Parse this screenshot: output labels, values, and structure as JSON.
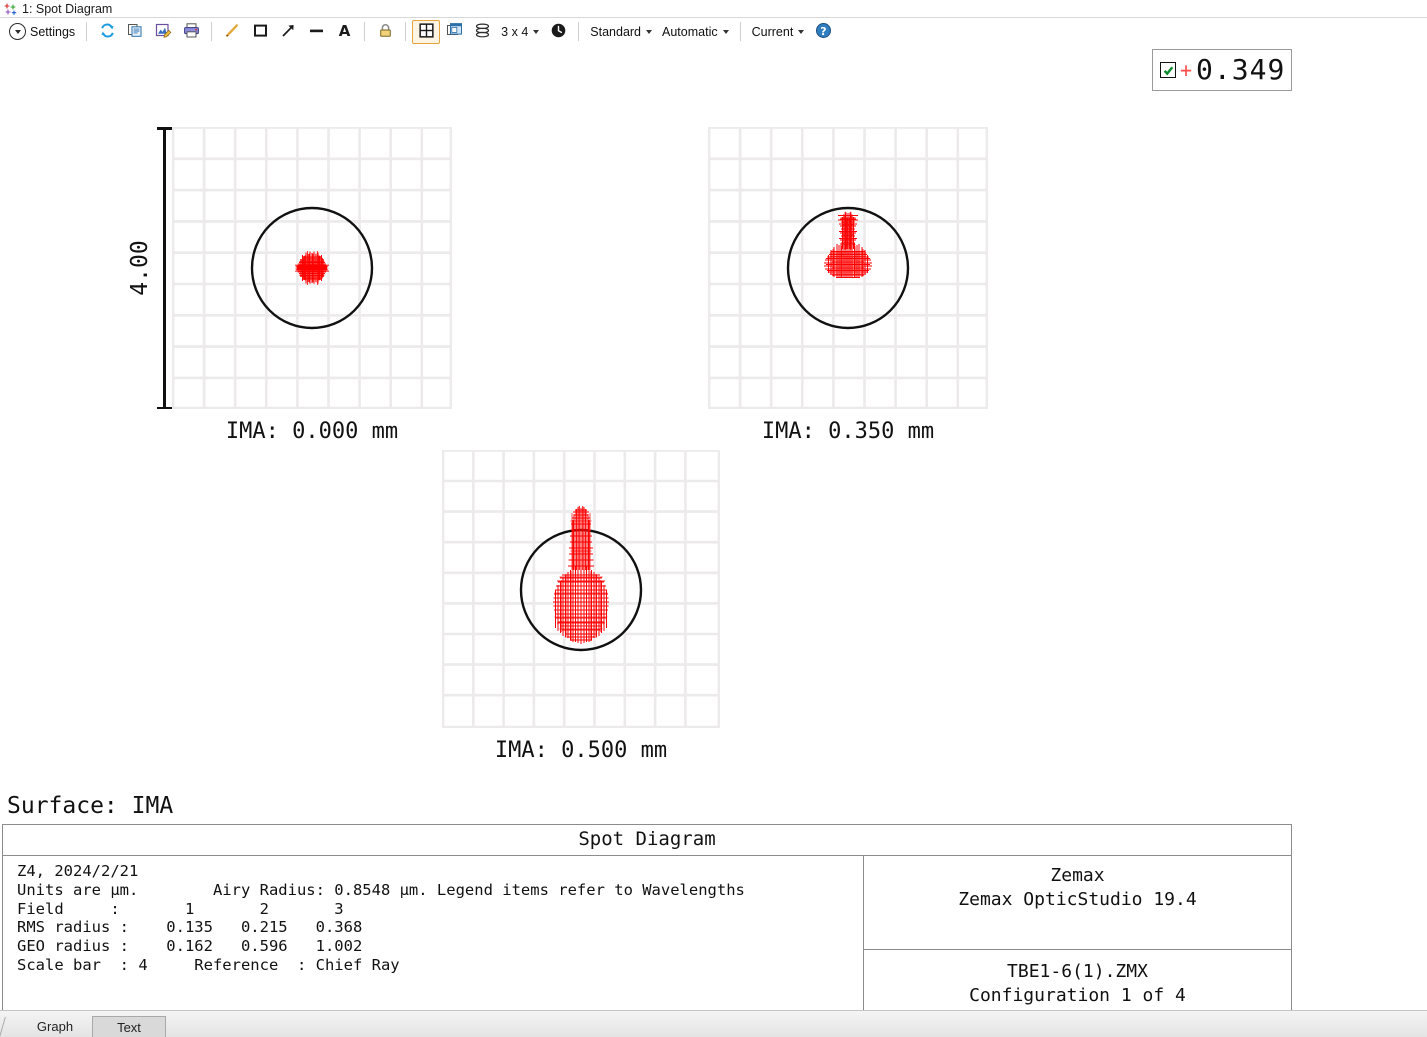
{
  "window": {
    "title": "1: Spot Diagram",
    "icon": "spot-diagram-icon"
  },
  "toolbar": {
    "settings_label": "Settings",
    "buttons": [
      {
        "name": "refresh-icon",
        "tip": "Refresh"
      },
      {
        "name": "copy-icon",
        "tip": "Copy"
      },
      {
        "name": "save-icon",
        "tip": "Save"
      },
      {
        "name": "print-icon",
        "tip": "Print"
      },
      {
        "name": "pencil-icon",
        "tip": "Line annotation"
      },
      {
        "name": "rectangle-icon",
        "tip": "Rectangle annotation"
      },
      {
        "name": "arrow-icon",
        "tip": "Arrow annotation"
      },
      {
        "name": "minus-icon",
        "tip": "Horizontal line"
      },
      {
        "name": "text-icon",
        "tip": "Text annotation"
      },
      {
        "name": "lock-icon",
        "tip": "Lock"
      },
      {
        "name": "grid-layout-icon",
        "tip": "Tile layout"
      },
      {
        "name": "window-copy-icon",
        "tip": "Clone window"
      },
      {
        "name": "layers-icon",
        "tip": "Layers"
      }
    ],
    "grid_size_label": "3 x 4",
    "clock_icon": "clock-icon",
    "dropdowns": [
      {
        "name": "style-dropdown",
        "label": "Standard"
      },
      {
        "name": "scale-dropdown",
        "label": "Automatic"
      },
      {
        "name": "config-dropdown",
        "label": "Current"
      }
    ],
    "help_icon": "help-icon"
  },
  "legend": {
    "checked": true,
    "marker": "+",
    "marker_color": "#ff4d4d",
    "value": "0.349"
  },
  "surface_title": "Surface: IMA",
  "scale_bar": {
    "value": "4.00"
  },
  "chart_data": {
    "type": "scatter",
    "title": "Spot Diagram",
    "subtitle": "Surface: IMA",
    "units": "µm",
    "scale_bar_um": 4.0,
    "airy_radius_um": 0.8548,
    "wavelength_um": 0.349,
    "reference": "Chief Ray",
    "grid": true,
    "grid_cells": 9,
    "xlabel": "",
    "ylabel": "",
    "panels": [
      {
        "field": 1,
        "label": "IMA:  0.000  mm",
        "ima_mm": 0.0,
        "rms_radius_um": 0.135,
        "geo_radius_um": 0.162,
        "airy_circle_radius_frac": 0.215,
        "spot_shape": "round-compact",
        "spot_center": [
          0.0,
          0.0
        ],
        "spot_width_frac": 0.072,
        "spot_height_frac": 0.072
      },
      {
        "field": 2,
        "label": "IMA:  0.350  mm",
        "ima_mm": 0.35,
        "rms_radius_um": 0.215,
        "geo_radius_um": 0.596,
        "airy_circle_radius_frac": 0.215,
        "spot_shape": "comet-mushroom",
        "spot_center": [
          0.0,
          0.03
        ],
        "spot_width_frac": 0.12,
        "spot_height_frac": 0.2
      },
      {
        "field": 3,
        "label": "IMA:  0.500  mm",
        "ima_mm": 0.5,
        "rms_radius_um": 0.368,
        "geo_radius_um": 1.002,
        "airy_circle_radius_frac": 0.215,
        "spot_shape": "teardrop",
        "spot_center": [
          0.0,
          0.02
        ],
        "spot_width_frac": 0.2,
        "spot_height_frac": 0.4
      }
    ],
    "legend_note": "Legend items refer to Wavelengths",
    "series": [
      {
        "name": "0.349",
        "color": "#ff0000",
        "marker": "+"
      }
    ]
  },
  "info": {
    "header": "Spot Diagram",
    "lines": [
      "Z4, 2024/2/21",
      "Units are µm.        Airy Radius: 0.8548 µm. Legend items refer to Wavelengths",
      "Field     :       1       2       3",
      "RMS radius :    0.135   0.215   0.368",
      "GEO radius :    0.162   0.596   1.002",
      "Scale bar  : 4     Reference  : Chief Ray"
    ],
    "vendor": "Zemax",
    "product": "Zemax OpticStudio 19.4",
    "file": "TBE1-6(1).ZMX",
    "configuration": "Configuration 1 of 4"
  },
  "tabs": [
    {
      "label": "Graph",
      "active": false
    },
    {
      "label": "Text",
      "active": true
    }
  ]
}
